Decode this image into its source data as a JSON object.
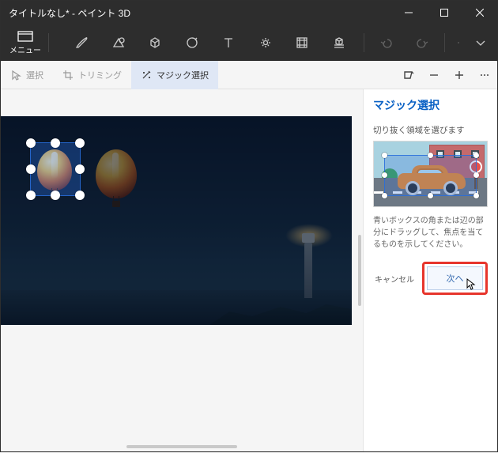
{
  "window": {
    "title": "タイトルなし* - ペイント 3D"
  },
  "menu": {
    "label": "メニュー"
  },
  "topTools": {
    "brush": "brush-icon",
    "shapes2d": "shapes-2d-icon",
    "shapes3d": "shapes-3d-icon",
    "stickers": "stickers-icon",
    "text": "text-icon",
    "effects": "effects-icon",
    "canvas": "canvas-icon",
    "library": "3d-library-icon",
    "undo": "undo-icon",
    "redo": "redo-icon",
    "paste": "paste-icon",
    "history": "history-dropdown-icon"
  },
  "secondary": {
    "select": {
      "label": "選択"
    },
    "crop": {
      "label": "トリミング"
    },
    "magicSelect": {
      "label": "マジック選択"
    },
    "view3d": "3D 表示",
    "zoomOut": "−",
    "zoomIn": "+",
    "more": "⋯"
  },
  "panel": {
    "title": "マジック選択",
    "section": "切り抜く領域を選びます",
    "hint": "青いボックスの角または辺の部分にドラッグして、焦点を当てるものを示してください。",
    "cancel": "キャンセル",
    "next": "次へ"
  }
}
